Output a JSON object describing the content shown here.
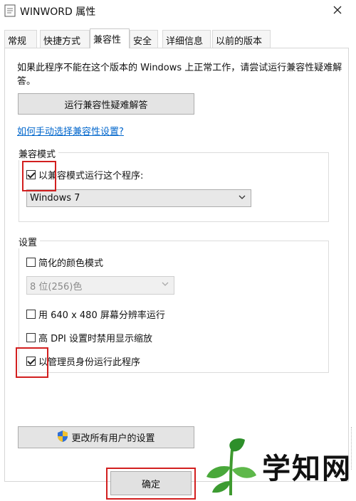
{
  "window": {
    "title": "WINWORD 属性",
    "close_icon": "close-icon",
    "app_icon": "document-icon"
  },
  "tabs": [
    {
      "label": "常规",
      "active": false
    },
    {
      "label": "快捷方式",
      "active": false
    },
    {
      "label": "兼容性",
      "active": true
    },
    {
      "label": "安全",
      "active": false
    },
    {
      "label": "详细信息",
      "active": false
    },
    {
      "label": "以前的版本",
      "active": false
    }
  ],
  "compat": {
    "intro": "如果此程序不能在这个版本的 Windows 上正常工作，请尝试运行兼容性疑难解答。",
    "troubleshoot_button": "运行兼容性疑难解答",
    "manual_link": "如何手动选择兼容性设置?"
  },
  "compat_mode": {
    "group_label": "兼容模式",
    "checkbox_label": "以兼容模式运行这个程序:",
    "checked": true,
    "os_selected": "Windows 7"
  },
  "settings": {
    "group_label": "设置",
    "reduced_color": {
      "label": "简化的颜色模式",
      "checked": false
    },
    "color_depth": "8 位(256)色",
    "res_640": {
      "label": "用 640 x 480 屏幕分辨率运行",
      "checked": false
    },
    "high_dpi": {
      "label": "高 DPI 设置时禁用显示缩放",
      "checked": false
    },
    "run_as_admin": {
      "label": "以管理员身份运行此程序",
      "checked": true
    }
  },
  "buttons": {
    "all_users": "更改所有用户的设置",
    "ok": "确定"
  },
  "watermark": {
    "text": "学知网"
  },
  "colors": {
    "highlight": "#d21f1f",
    "link": "#0066cc"
  }
}
